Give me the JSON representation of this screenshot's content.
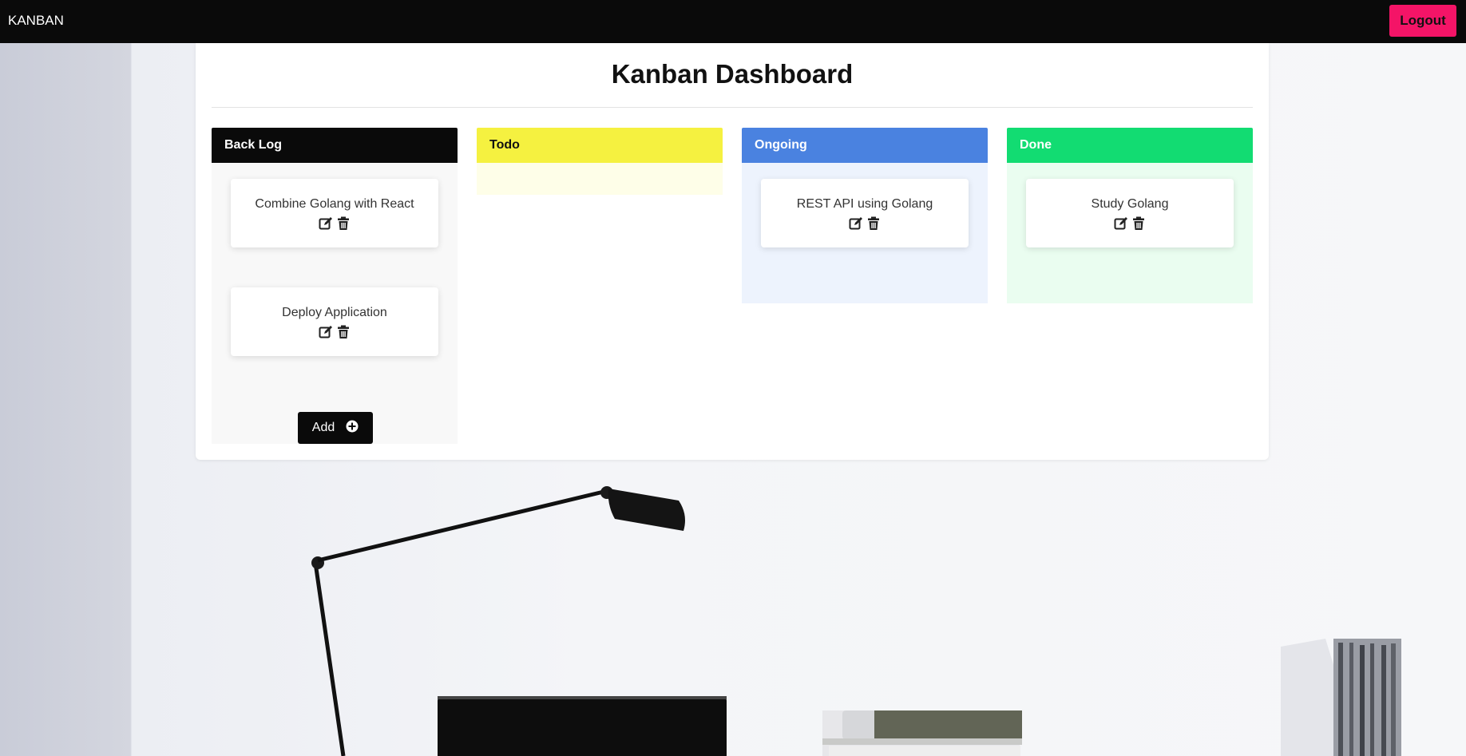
{
  "navbar": {
    "brand": "KANBAN",
    "logout_label": "Logout",
    "logout_color": "#f41467"
  },
  "dashboard": {
    "title": "Kanban Dashboard"
  },
  "columns": [
    {
      "title": "Back Log",
      "header_color": "#0a0a0a",
      "header_text_color": "#ffffff",
      "body_color": "#f8f8f8",
      "cards": [
        {
          "title": "Combine Golang with React"
        },
        {
          "title": "Deploy Application"
        }
      ],
      "add_label": "Add"
    },
    {
      "title": "Todo",
      "header_color": "#f5f140",
      "header_text_color": "#111111",
      "body_color": "#fefee8",
      "cards": []
    },
    {
      "title": "Ongoing",
      "header_color": "#4a82e0",
      "header_text_color": "#ffffff",
      "body_color": "#edf3fd",
      "cards": [
        {
          "title": "REST API using Golang"
        }
      ]
    },
    {
      "title": "Done",
      "header_color": "#12dc72",
      "header_text_color": "#ffffff",
      "body_color": "#eafdf0",
      "cards": [
        {
          "title": "Study Golang"
        }
      ]
    }
  ],
  "icons": {
    "edit": "edit-icon",
    "delete": "trash-icon",
    "add": "plus-circle-icon"
  }
}
